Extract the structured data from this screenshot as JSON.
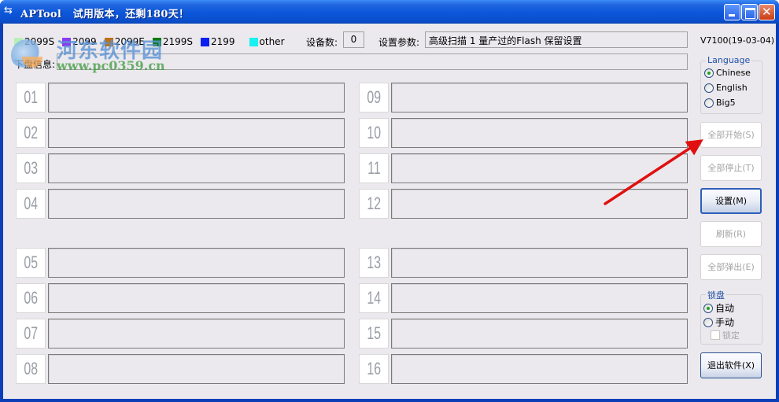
{
  "window": {
    "app_name": "APTool",
    "trial_notice": "试用版本，还剩180天！",
    "icon": "usb-icon",
    "controls": {
      "minimize": "minimize-icon",
      "maximize": "maximize-icon",
      "close": "close-icon"
    }
  },
  "watermark": {
    "text": "河东软件园",
    "url": "www.pc0359.cn"
  },
  "legend": [
    {
      "label": "2099S",
      "color": "#b7f0b7"
    },
    {
      "label": "2099",
      "color": "#8b3cf0"
    },
    {
      "label": "2099E",
      "color": "#c0700f"
    },
    {
      "label": "2199S",
      "color": "#0a7a10"
    },
    {
      "label": "2199",
      "color": "#0a1ff0"
    },
    {
      "label": "other",
      "color": "#19f0f0"
    }
  ],
  "device_count": {
    "label": "设备数:",
    "value": "0"
  },
  "settings_param": {
    "label": "设置参数:",
    "value": "高级扫描 1 量产过的Flash 保留设置"
  },
  "version": "V7100(19-03-04)",
  "disk_info": {
    "label": "下盘信息:",
    "value": ""
  },
  "slots": [
    {
      "num": "01",
      "status": ""
    },
    {
      "num": "02",
      "status": ""
    },
    {
      "num": "03",
      "status": ""
    },
    {
      "num": "04",
      "status": ""
    },
    {
      "num": "05",
      "status": ""
    },
    {
      "num": "06",
      "status": ""
    },
    {
      "num": "07",
      "status": ""
    },
    {
      "num": "08",
      "status": ""
    },
    {
      "num": "09",
      "status": ""
    },
    {
      "num": "10",
      "status": ""
    },
    {
      "num": "11",
      "status": ""
    },
    {
      "num": "12",
      "status": ""
    },
    {
      "num": "13",
      "status": ""
    },
    {
      "num": "14",
      "status": ""
    },
    {
      "num": "15",
      "status": ""
    },
    {
      "num": "16",
      "status": ""
    }
  ],
  "language": {
    "title": "Language",
    "options": [
      "Chinese",
      "English",
      "Big5"
    ],
    "selected": "Chinese"
  },
  "buttons": {
    "start_all": {
      "label": "全部开始(S)",
      "enabled": false
    },
    "stop_all": {
      "label": "全部停止(T)",
      "enabled": false
    },
    "settings": {
      "label": "设置(M)",
      "enabled": true
    },
    "refresh": {
      "label": "刷新(R)",
      "enabled": false
    },
    "eject_all": {
      "label": "全部弹出(E)",
      "enabled": false
    },
    "exit": {
      "label": "退出软件(X)",
      "enabled": true
    }
  },
  "lock": {
    "title": "锁盘",
    "options": [
      "自动",
      "手动"
    ],
    "selected": "自动",
    "lock_checkbox": {
      "label": "锁定",
      "checked": false,
      "enabled": false
    }
  },
  "annotation": {
    "type": "red-arrow",
    "points_to": "全部开始(S)",
    "color": "#e01010"
  }
}
